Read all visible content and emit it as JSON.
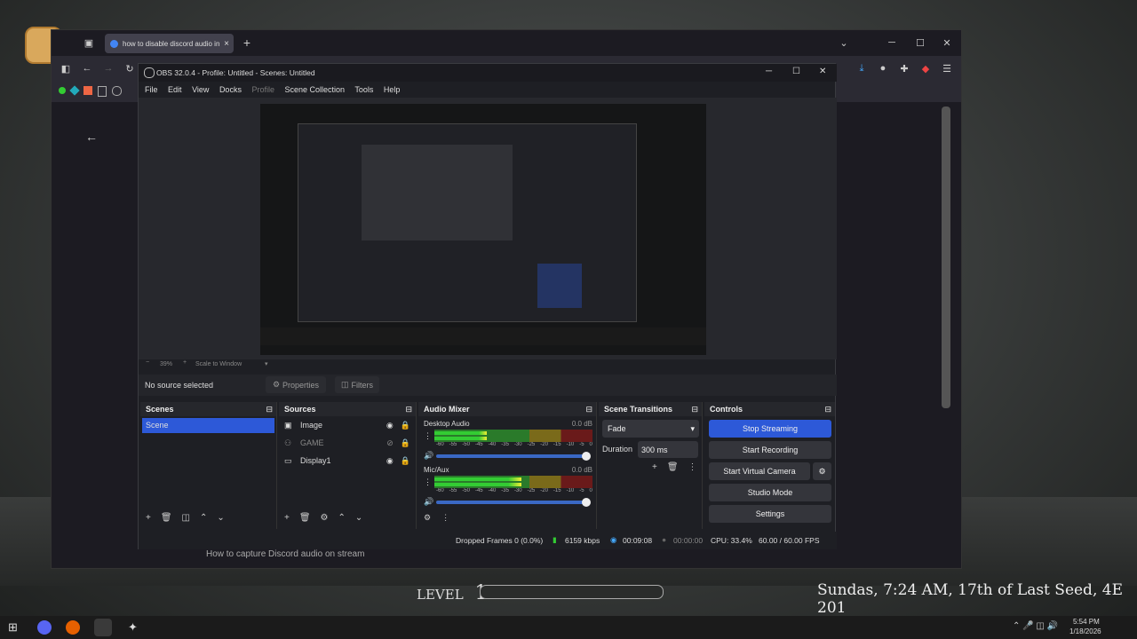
{
  "browser": {
    "tab_title": "how to disable discord audio in",
    "tab_close": "×",
    "new_tab": "+",
    "page_subtitle": "How to capture Discord audio on stream",
    "window_min": "─",
    "window_max": "☐",
    "window_close": "✕"
  },
  "obs": {
    "title": "OBS 32.0.4 - Profile: Untitled - Scenes: Untitled",
    "menu": [
      "File",
      "Edit",
      "View",
      "Docks",
      "Profile",
      "Scene Collection",
      "Tools",
      "Help"
    ],
    "zoom": "39%",
    "scale_label": "Scale to Window",
    "no_source": "No source selected",
    "properties_label": "Properties",
    "filters_label": "Filters",
    "scenes": {
      "title": "Scenes",
      "items": [
        "Scene"
      ]
    },
    "sources": {
      "title": "Sources",
      "items": [
        {
          "name": "Image",
          "icon": "image-icon",
          "visible": true
        },
        {
          "name": "GAME",
          "icon": "game-capture-icon",
          "visible": false
        },
        {
          "name": "Display1",
          "icon": "display-icon",
          "visible": true
        }
      ]
    },
    "audio_mixer": {
      "title": "Audio Mixer",
      "ticks": [
        "-60",
        "-55",
        "-50",
        "-45",
        "-40",
        "-35",
        "-30",
        "-25",
        "-20",
        "-15",
        "-10",
        "-5",
        "0"
      ],
      "channels": [
        {
          "name": "Desktop Audio",
          "db": "0.0 dB",
          "level": 0.33,
          "volume": 1.0
        },
        {
          "name": "Mic/Aux",
          "db": "0.0 dB",
          "level": 0.55,
          "volume": 1.0
        }
      ]
    },
    "transitions": {
      "title": "Scene Transitions",
      "selected": "Fade",
      "duration_label": "Duration",
      "duration_value": "300 ms"
    },
    "controls": {
      "title": "Controls",
      "stop_streaming": "Stop Streaming",
      "start_recording": "Start Recording",
      "start_virtual_camera": "Start Virtual Camera",
      "studio_mode": "Studio Mode",
      "settings": "Settings"
    },
    "status": {
      "dropped": "Dropped Frames 0 (0.0%)",
      "bitrate": "6159 kbps",
      "stream_time": "00:09:08",
      "rec_time": "00:00:00",
      "cpu": "CPU: 33.4%",
      "fps": "60.00 / 60.00 FPS"
    }
  },
  "hud": {
    "level_label": "LEVEL",
    "level_value": "1",
    "date_text": "Sundas, 7:24 AM, 17th of Last Seed, 4E 201"
  },
  "taskbar": {
    "time": "5:54 PM",
    "date": "1/18/2026"
  },
  "colors": {
    "accent": "#2d59d8",
    "meter_green": "#33cc33",
    "meter_yellow": "#eeee33",
    "meter_red": "#cc2222"
  }
}
